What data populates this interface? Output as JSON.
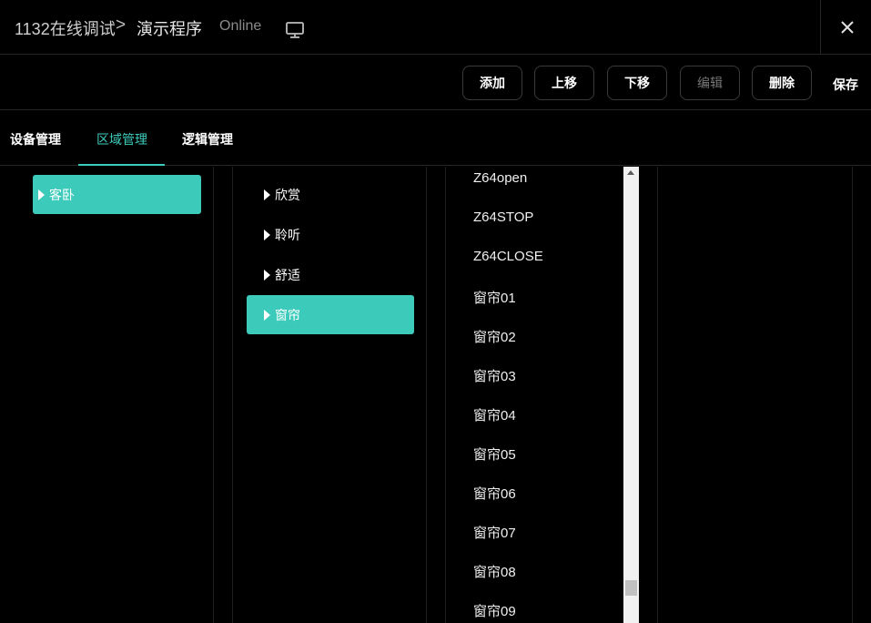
{
  "header": {
    "title": "1132在线调试",
    "separator": ">",
    "page": "演示程序",
    "status": "Online",
    "monitor_icon": "monitor-icon",
    "close_icon": "close-icon"
  },
  "toolbar": {
    "add_label": "添加",
    "up_label": "上移",
    "down_label": "下移",
    "edit_label": "编辑",
    "delete_label": "删除",
    "save_label": "保存"
  },
  "tabs": [
    {
      "label": "设备管理",
      "active": false
    },
    {
      "label": "区域管理",
      "active": true
    },
    {
      "label": "逻辑管理",
      "active": false
    }
  ],
  "rooms": [
    {
      "label": "客卧",
      "selected": true
    }
  ],
  "scenes": [
    {
      "label": "欣赏",
      "selected": false
    },
    {
      "label": "聆听",
      "selected": false
    },
    {
      "label": "舒适",
      "selected": false
    },
    {
      "label": "窗帘",
      "selected": true
    }
  ],
  "commands": [
    "Z64open",
    "Z64STOP",
    "Z64CLOSE",
    "窗帘01",
    "窗帘02",
    "窗帘03",
    "窗帘04",
    "窗帘05",
    "窗帘06",
    "窗帘07",
    "窗帘08",
    "窗帘09"
  ],
  "colors": {
    "accent": "#3ccbbb",
    "background": "#000000",
    "border": "#262626"
  }
}
